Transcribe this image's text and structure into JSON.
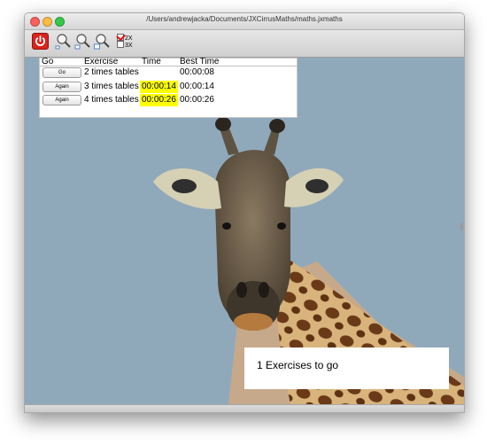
{
  "window": {
    "title": "/Users/andrewjacka/Documents/JXCirrusMaths/maths.jxmaths"
  },
  "toolbar": {
    "buttons": [
      {
        "icon": "power-icon"
      },
      {
        "icon": "zoom-out-icon"
      },
      {
        "icon": "zoom-reset-icon"
      },
      {
        "icon": "zoom-in-icon"
      }
    ],
    "options": [
      {
        "label": "2X",
        "checked": true
      },
      {
        "label": "3X",
        "checked": false
      }
    ]
  },
  "table": {
    "headers": {
      "go": "Go",
      "exercise": "Exercise",
      "time": "Time",
      "best_time": "Best Time"
    },
    "rows": [
      {
        "button": "Go",
        "exercise": "2 times tables",
        "time": "",
        "best_time": "00:00:08",
        "highlight": false
      },
      {
        "button": "Again",
        "exercise": "3 times tables",
        "time": "00:00:14",
        "best_time": "00:00:14",
        "highlight": true
      },
      {
        "button": "Again",
        "exercise": "4 times tables",
        "time": "00:00:26",
        "best_time": "00:00:26",
        "highlight": true
      }
    ]
  },
  "status": {
    "text": "1 Exercises to go"
  },
  "colors": {
    "highlight": "#ffff00",
    "power": "#d8241d",
    "sky": "#8fa9bb"
  }
}
